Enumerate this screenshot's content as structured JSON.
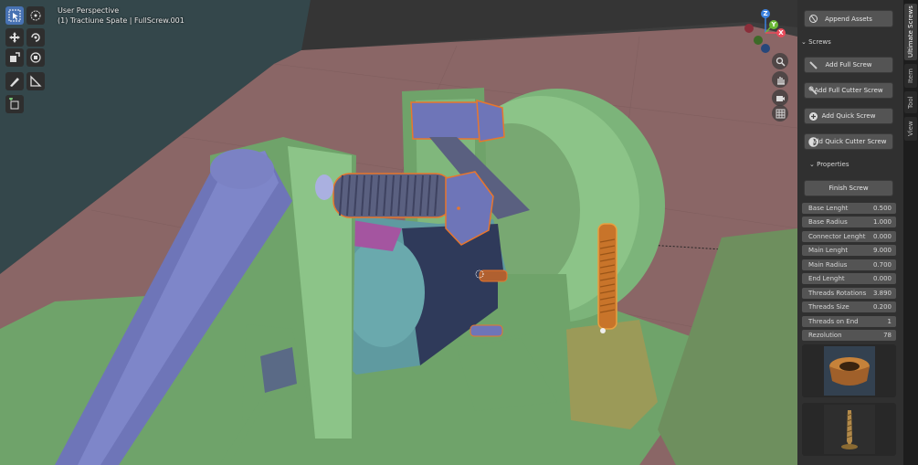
{
  "viewport": {
    "view_name": "User Perspective",
    "object_info": "(1) Tractiune Spate | FullScrew.001"
  },
  "toolbar": {
    "tools": [
      "select-box",
      "cursor",
      "move",
      "rotate",
      "scale",
      "transform",
      "annotate",
      "measure",
      "add-cube"
    ]
  },
  "gizmo": {
    "z_label": "Z",
    "y_label": "Y",
    "x_label": "X",
    "colors": {
      "x": "#e84a5a",
      "y": "#6bb836",
      "z": "#3b82e0"
    }
  },
  "nav_icons": [
    "zoom-icon",
    "pan-hand-icon",
    "camera-icon",
    "grid-ortho-icon"
  ],
  "panel": {
    "append_label": "Append Assets",
    "screws_header": "Screws",
    "buttons": [
      "Add Full Screw",
      "Add Full Cutter Screw",
      "Add Quick Screw",
      "Add Quick Cutter Screw"
    ],
    "properties_header": "Properties",
    "finish_label": "Finish Screw",
    "properties": [
      {
        "label": "Base Lenght",
        "value": "0.500"
      },
      {
        "label": "Base Radius",
        "value": "1.000"
      },
      {
        "label": "Connector Lenght",
        "value": "0.000"
      },
      {
        "label": "Main Lenght",
        "value": "9.000"
      },
      {
        "label": "Main Radius",
        "value": "0.700"
      },
      {
        "label": "End Lenght",
        "value": "0.000"
      },
      {
        "label": "Threads Rotations",
        "value": "3.890"
      },
      {
        "label": "Threads Size",
        "value": "0.200"
      },
      {
        "label": "Threads on End",
        "value": "1"
      },
      {
        "label": "Rezolution",
        "value": "78"
      }
    ]
  },
  "tabs": [
    "Ultimate Screws",
    "Item",
    "Tool",
    "View"
  ],
  "colors": {
    "accent": "#4772b3",
    "selection_outline": "#e8762d",
    "panel_bg": "#303030",
    "button_bg": "#545454"
  }
}
